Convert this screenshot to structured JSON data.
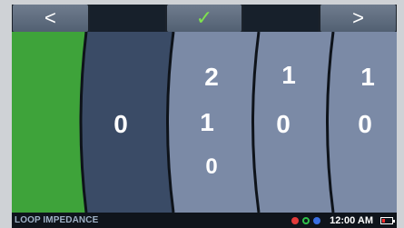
{
  "toolbar": {
    "prev_label": "<",
    "confirm_label": "✓",
    "next_label": ">",
    "confirm_color": "#7ee24e"
  },
  "dials": {
    "wheel_1": {
      "current": "0"
    },
    "wheel_2": {
      "previous": "2",
      "current": "1",
      "next": "0"
    },
    "wheel_3": {
      "previous": "1",
      "current": "0"
    },
    "wheel_4": {
      "previous": "1",
      "current": "0"
    }
  },
  "status": {
    "title": "LOOP IMPEDANCE",
    "time": "12:00 AM",
    "indicator_colors": [
      "#e23a3a",
      "#2fbf4a",
      "#3a6ee2"
    ],
    "battery_level": 0.3,
    "battery_color": "#ff2a2a"
  },
  "colors": {
    "green_panel": "#3ea33a",
    "wheel_dark": "#3a4b66",
    "wheel_light": "#7b8aa6"
  }
}
